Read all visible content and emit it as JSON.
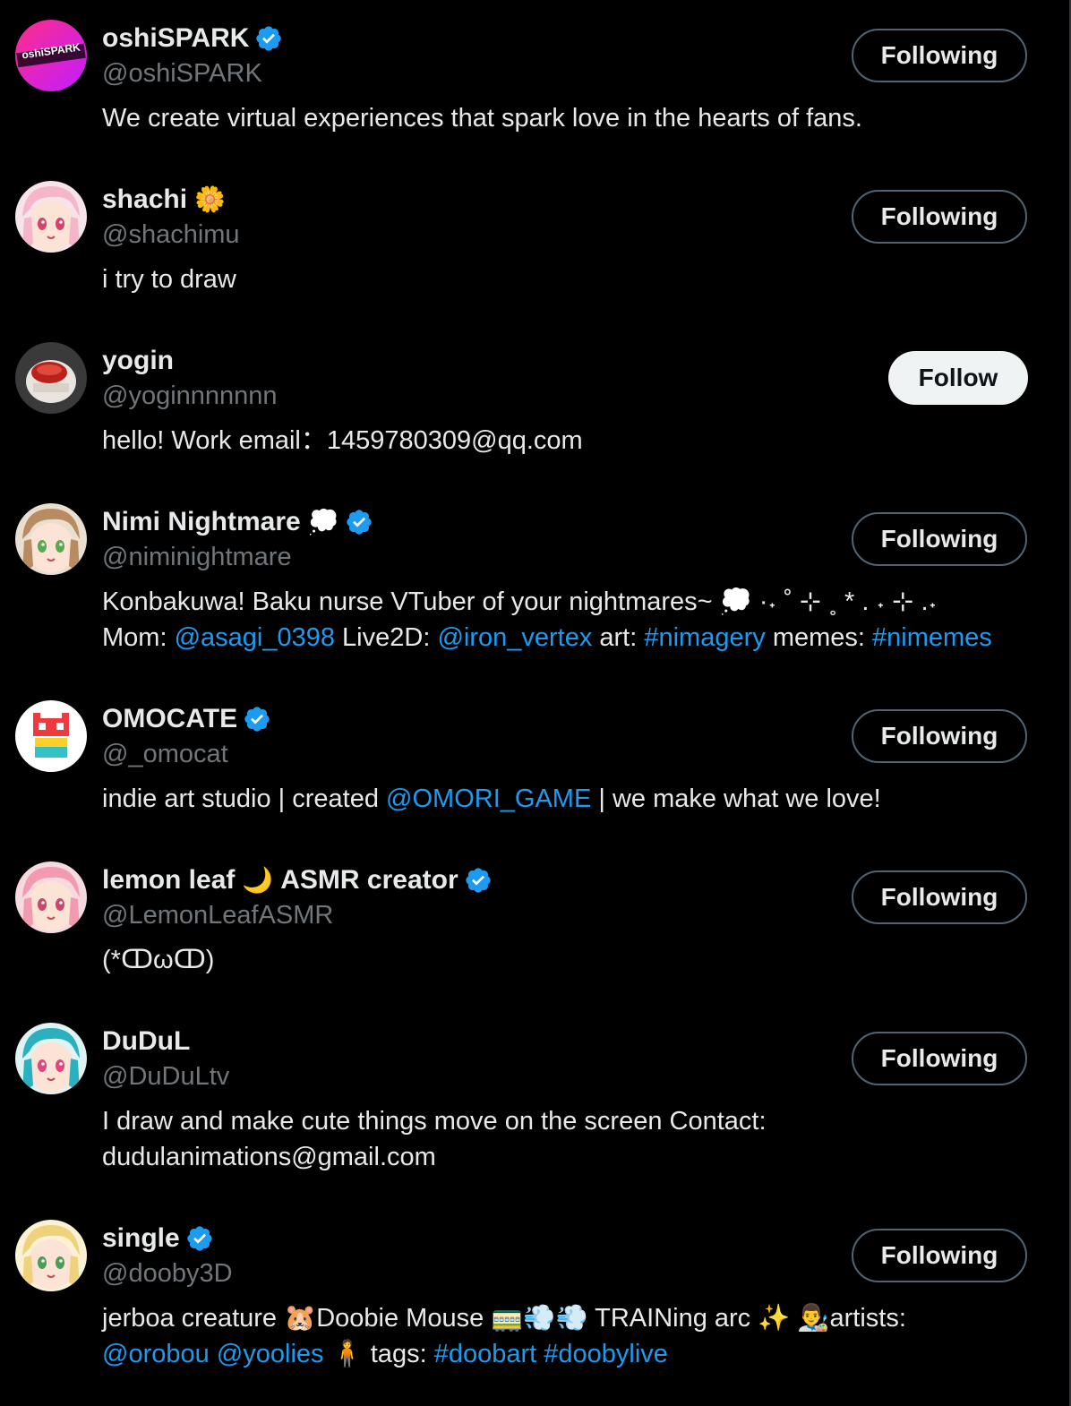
{
  "accounts": [
    {
      "name": "oshiSPARK",
      "emoji": "",
      "verified": true,
      "handle": "@oshiSPARK",
      "bio": [
        {
          "t": "We create virtual experiences that spark love in the hearts of fans.",
          "link": false
        }
      ],
      "button": "Following",
      "avatar": {
        "type": "logo",
        "text": "oshiSPARK",
        "colors": [
          "#ff2d8a",
          "#c21cff"
        ]
      }
    },
    {
      "name": "shachi",
      "emoji": "🌼",
      "verified": false,
      "handle": "@shachimu",
      "bio": [
        {
          "t": "i try to draw",
          "link": false
        }
      ],
      "button": "Following",
      "avatar": {
        "type": "anime",
        "hair": "#f4b6c8",
        "bg": "#f7e3ea",
        "eye": "#d7416e"
      }
    },
    {
      "name": "yogin",
      "emoji": "",
      "verified": false,
      "handle": "@yoginnnnnnn",
      "bio": [
        {
          "t": "hello! Work email：1459780309@qq.com",
          "link": false
        }
      ],
      "button": "Follow",
      "avatar": {
        "type": "object",
        "bg": "#3a3a3a"
      }
    },
    {
      "name": "Nimi Nightmare",
      "emoji": "💭",
      "verified": true,
      "handle": "@niminightmare",
      "bio": [
        {
          "t": "Konbakuwa! Baku nurse VTuber of your nightmares~ 💭 ·˖ ˚ ⊹ ˳ * . ˖ ⊹ .˖",
          "link": false
        },
        {
          "br": true
        },
        {
          "t": "Mom: ",
          "link": false
        },
        {
          "t": "@asagi_0398",
          "link": true
        },
        {
          "t": " Live2D: ",
          "link": false
        },
        {
          "t": "@iron_vertex",
          "link": true
        },
        {
          "t": " art: ",
          "link": false
        },
        {
          "t": "#nimagery",
          "link": true
        },
        {
          "t": " memes: ",
          "link": false
        },
        {
          "t": "#nimemes",
          "link": true
        }
      ],
      "button": "Following",
      "avatar": {
        "type": "anime",
        "hair": "#b88b62",
        "bg": "#e9ded0",
        "eye": "#5aa84f"
      }
    },
    {
      "name": "OMOCATE",
      "emoji": "",
      "verified": true,
      "handle": "@_omocat",
      "bio": [
        {
          "t": "indie art studio | created ",
          "link": false
        },
        {
          "t": "@OMORI_GAME",
          "link": true
        },
        {
          "t": " | we make what we love!",
          "link": false
        }
      ],
      "button": "Following",
      "avatar": {
        "type": "omocat",
        "bg": "#ffffff"
      }
    },
    {
      "name": "lemon leaf",
      "emoji": "🌙",
      "name2": "ASMR creator",
      "verified": true,
      "handle": "@LemonLeafASMR",
      "bio": [
        {
          "t": "(*ↀωↀ)",
          "link": false
        }
      ],
      "button": "Following",
      "avatar": {
        "type": "anime",
        "hair": "#f29ab0",
        "bg": "#f7d9e0",
        "eye": "#c9476b"
      }
    },
    {
      "name": "DuDuL",
      "emoji": "",
      "verified": false,
      "handle": "@DuDuLtv",
      "bio": [
        {
          "t": "I draw and make cute things move on the screen Contact: dudulanimations@gmail.com",
          "link": false
        }
      ],
      "button": "Following",
      "avatar": {
        "type": "anime",
        "hair": "#2bb0bf",
        "bg": "#dff2f4",
        "eye": "#e0457b"
      }
    },
    {
      "name": "single",
      "emoji": "",
      "verified": true,
      "handle": "@dooby3D",
      "bio": [
        {
          "t": "jerboa creature 🐹Doobie Mouse 🚃💨💨 TRAINing arc ✨ 👨‍🎨artists:",
          "link": false
        },
        {
          "br": true
        },
        {
          "t": "@orobou",
          "link": true
        },
        {
          "t": " ",
          "link": false
        },
        {
          "t": "@yoolies",
          "link": true
        },
        {
          "t": " 🧍 tags: ",
          "link": false
        },
        {
          "t": "#doobart",
          "link": true
        },
        {
          "t": " ",
          "link": false
        },
        {
          "t": "#doobylive",
          "link": true
        }
      ],
      "button": "Following",
      "avatar": {
        "type": "anime",
        "hair": "#f1d27c",
        "bg": "#fbf1d4",
        "eye": "#4c9c56"
      }
    }
  ],
  "colors": {
    "background": "#000000",
    "text": "#e7e9ea",
    "secondary": "#71767b",
    "link": "#1d9bf0",
    "verified": "#1d9bf0",
    "button_border": "#536471"
  }
}
